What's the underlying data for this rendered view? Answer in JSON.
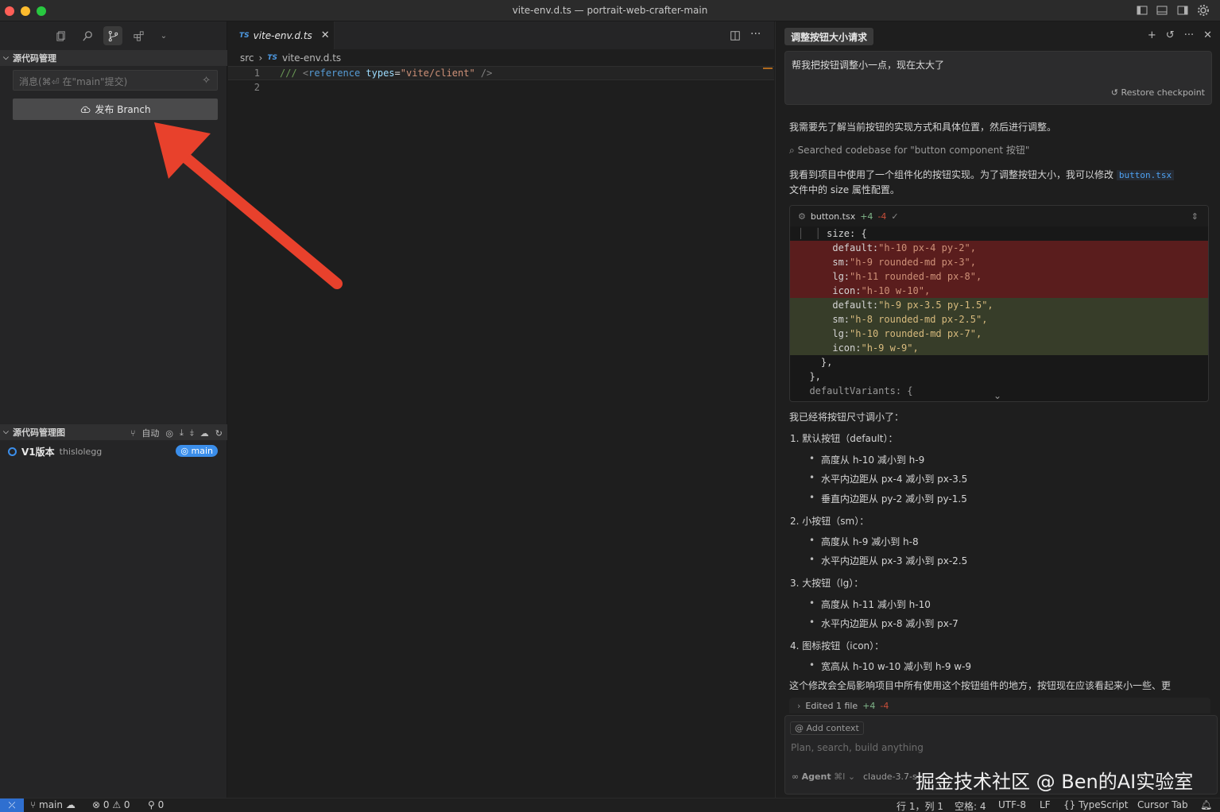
{
  "window": {
    "title": "vite-env.d.ts — portrait-web-crafter-main"
  },
  "sidebar": {
    "scm_header": "源代码管理",
    "commit_placeholder": "消息(⌘⏎ 在\"main\"提交)",
    "publish_label": "发布 Branch",
    "graph_header": "源代码管理图",
    "auto_label": "自动",
    "graph_item": {
      "title": "V1版本",
      "author": "thislolegg",
      "branch_badge": "main"
    }
  },
  "editor": {
    "tab_name": "vite-env.d.ts",
    "file_badge": "TS",
    "breadcrumb": [
      "src",
      "vite-env.d.ts"
    ],
    "lines": [
      {
        "num": "1",
        "text": "/// <reference types=\"vite/client\" />"
      },
      {
        "num": "2",
        "text": ""
      }
    ]
  },
  "chat": {
    "tab_title": "调整按钮大小请求",
    "user_message": "帮我把按钮调整小一点，现在太大了",
    "restore_label": "Restore checkpoint",
    "p1": "我需要先了解当前按钮的实现方式和具体位置，然后进行调整。",
    "searched": "Searched codebase for \"button component 按钮\"",
    "p2_a": "我看到项目中使用了一个组件化的按钮实现。为了调整按钮大小，我可以修改",
    "p2_code": "button.tsx",
    "p2_b": "文件中的 size 属性配置。",
    "diff": {
      "file": "button.tsx",
      "plus": "+4",
      "minus": "-4",
      "check": "✓",
      "size_open": "size: {",
      "removed": [
        {
          "key": "default:",
          "value": "\"h-10 px-4 py-2\","
        },
        {
          "key": "sm:",
          "value": "\"h-9 rounded-md px-3\","
        },
        {
          "key": "lg:",
          "value": "\"h-11 rounded-md px-8\","
        },
        {
          "key": "icon:",
          "value": "\"h-10 w-10\","
        }
      ],
      "added": [
        {
          "key": "default:",
          "value": "\"h-9 px-3.5 py-1.5\","
        },
        {
          "key": "sm:",
          "value": "\"h-8 rounded-md px-2.5\","
        },
        {
          "key": "lg:",
          "value": "\"h-10 rounded-md px-7\","
        },
        {
          "key": "icon:",
          "value": "\"h-9 w-9\","
        }
      ],
      "close1": "},",
      "close2": "},",
      "tail": "defaultVariants: {"
    },
    "summary_title": "我已经将按钮尺寸调小了：",
    "groups": [
      {
        "title": "1. 默认按钮（default）：",
        "items": [
          "高度从 h-10 减小到 h-9",
          "水平内边距从 px-4 减小到 px-3.5",
          "垂直内边距从 py-2 减小到 py-1.5"
        ]
      },
      {
        "title": "2. 小按钮（sm）：",
        "items": [
          "高度从 h-9 减小到 h-8",
          "水平内边距从 px-3 减小到 px-2.5"
        ]
      },
      {
        "title": "3. 大按钮（lg）：",
        "items": [
          "高度从 h-11 减小到 h-10",
          "水平内边距从 px-8 减小到 px-7"
        ]
      },
      {
        "title": "4. 图标按钮（icon）：",
        "items": [
          "宽高从 h-10 w-10 减小到 h-9 w-9"
        ]
      }
    ],
    "closing": "这个修改会全局影响项目中所有使用这个按钮组件的地方，按钮现在应该看起来小一些、更",
    "edited_label": "Edited 1 file",
    "edited_plus": "+4",
    "edited_minus": "-4",
    "add_context": "Add context",
    "composer_placeholder": "Plan, search, build anything",
    "agent_label": "Agent",
    "agent_shortcut": "⌘I",
    "model_label": "claude-3.7-s",
    "watermark": "掘金技术社区 @ Ben的AI实验室"
  },
  "statusbar": {
    "branch": "main",
    "errors": "0",
    "warnings": "0",
    "ports": "0",
    "position": "行 1，列 1",
    "spaces": "空格: 4",
    "encoding": "UTF-8",
    "eol": "LF",
    "language": "TypeScript",
    "cursor_tab": "Cursor Tab"
  },
  "colors": {
    "accent": "#3b8eea",
    "arrow": "#e8412c",
    "diff_removed": "#5a1d1d",
    "diff_added": "#373d29"
  }
}
